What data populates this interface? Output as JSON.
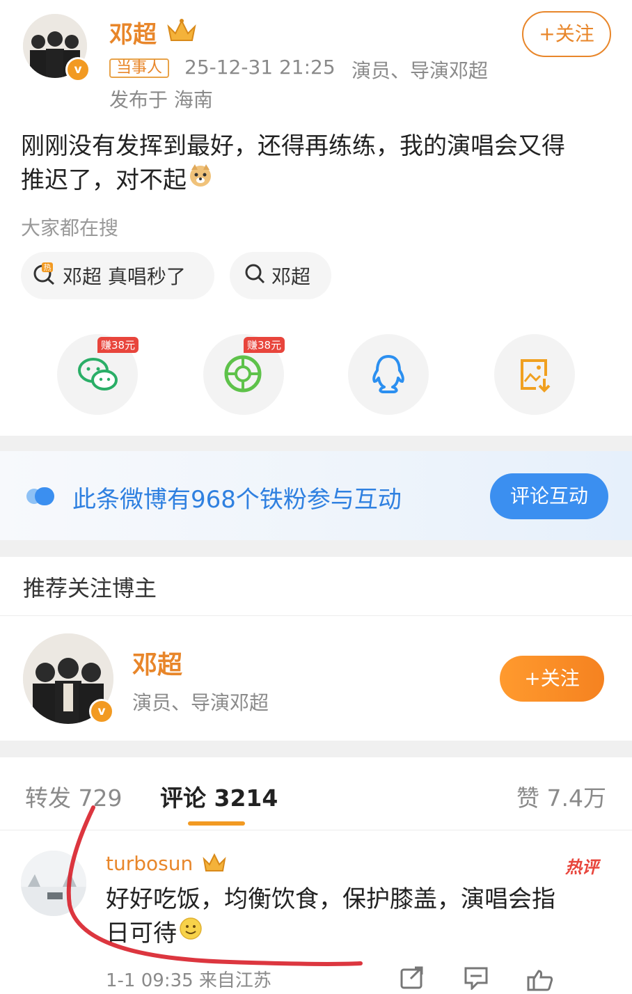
{
  "post": {
    "author_name": "邓超",
    "tag": "当事人",
    "timestamp": "25-12-31 21:25",
    "author_desc": "演员、导演邓超",
    "location": "发布于 海南",
    "follow_label": "+关注",
    "content_line1": "刚刚没有发挥到最好，还得再练练，我的演唱会又得",
    "content_line2": "推迟了，对不起"
  },
  "search": {
    "heading": "大家都在搜",
    "chips": [
      {
        "label": "邓超 真唱秒了",
        "icon": "hot-search-icon"
      },
      {
        "label": "邓超",
        "icon": "search-icon"
      }
    ]
  },
  "share": {
    "items": [
      {
        "icon": "wechat-icon",
        "badge": "赚38元",
        "color": "#2aae67"
      },
      {
        "icon": "moments-icon",
        "badge": "赚38元",
        "color": "#5ec24a"
      },
      {
        "icon": "qq-icon",
        "badge": "",
        "color": "#2b8ff0"
      },
      {
        "icon": "save-image-icon",
        "badge": "",
        "color": "#f0a020"
      }
    ]
  },
  "banner": {
    "text": "此条微博有968个铁粉参与互动",
    "button": "评论互动"
  },
  "recommend": {
    "heading": "推荐关注博主",
    "name": "邓超",
    "desc": "演员、导演邓超",
    "follow_label": "+关注"
  },
  "tabs": {
    "repost": "转发 729",
    "comments": "评论 3214",
    "likes": "赞 7.4万"
  },
  "comment": {
    "username": "turbosun",
    "hot_label": "热评",
    "text_line1": "好好吃饭，均衡饮食，保护膝盖，演唱会指",
    "text_line2": "日可待",
    "meta": "1-1 09:35 来自江苏"
  },
  "colors": {
    "accent": "#e8862a",
    "blue": "#3b8ff0",
    "hot": "#e8453c"
  }
}
